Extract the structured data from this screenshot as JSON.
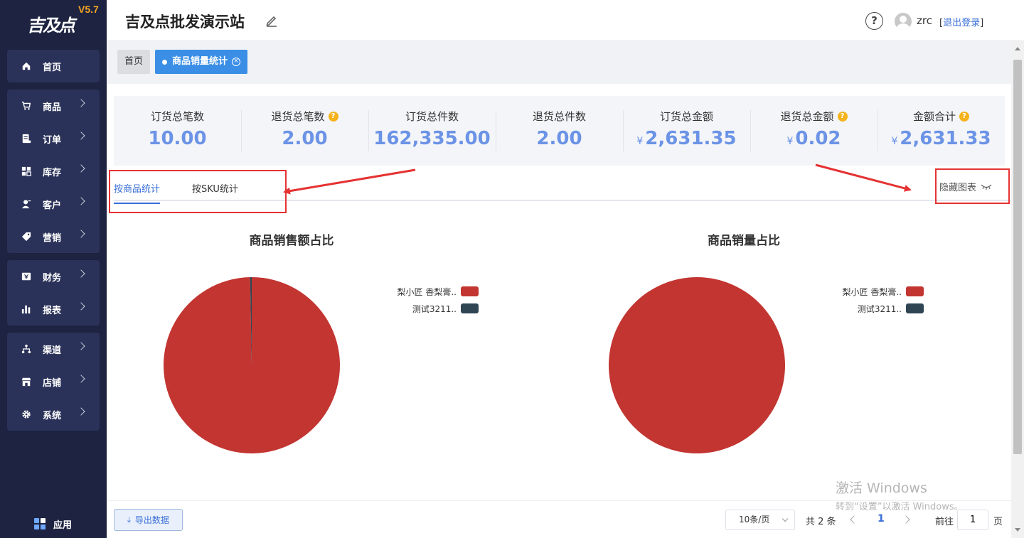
{
  "sidebar": {
    "logo_text": "吉及点",
    "version": "V5.7",
    "groups": [
      [
        {
          "label": "首页",
          "icon": "home-icon",
          "chevron": false
        }
      ],
      [
        {
          "label": "商品",
          "icon": "cart-icon",
          "chevron": true
        },
        {
          "label": "订单",
          "icon": "order-icon",
          "chevron": true
        },
        {
          "label": "库存",
          "icon": "stock-icon",
          "chevron": true
        },
        {
          "label": "客户",
          "icon": "customer-icon",
          "chevron": true
        },
        {
          "label": "营销",
          "icon": "tag-icon",
          "chevron": true
        }
      ],
      [
        {
          "label": "财务",
          "icon": "finance-icon",
          "chevron": true
        },
        {
          "label": "报表",
          "icon": "report-icon",
          "chevron": true
        }
      ],
      [
        {
          "label": "渠道",
          "icon": "channel-icon",
          "chevron": true
        },
        {
          "label": "店铺",
          "icon": "store-icon",
          "chevron": true
        },
        {
          "label": "系统",
          "icon": "gear-icon",
          "chevron": true
        }
      ]
    ],
    "app_label": "应用"
  },
  "header": {
    "title": "吉及点批发演示站",
    "help": "?",
    "username": "zrc",
    "logout_open": "[",
    "logout_label": "退出登录",
    "logout_close": "]"
  },
  "tabs": {
    "home": "首页",
    "active": "商品销量统计",
    "close": "×"
  },
  "stats": [
    {
      "label": "订货总笔数",
      "value": "10.00",
      "help": false,
      "currency": ""
    },
    {
      "label": "退货总笔数",
      "value": "2.00",
      "help": true,
      "currency": ""
    },
    {
      "label": "订货总件数",
      "value": "162,335.00",
      "help": false,
      "currency": ""
    },
    {
      "label": "退货总件数",
      "value": "2.00",
      "help": false,
      "currency": ""
    },
    {
      "label": "订货总金额",
      "value": "2,631.35",
      "help": false,
      "currency": "¥"
    },
    {
      "label": "退货总金额",
      "value": "0.02",
      "help": true,
      "currency": "¥"
    },
    {
      "label": "金额合计",
      "value": "2,631.33",
      "help": true,
      "currency": "¥"
    }
  ],
  "help_glyph": "?",
  "subtabs": {
    "by_product": "按商品统计",
    "by_sku": "按SKU统计"
  },
  "hide_chart_label": "隐藏图表",
  "chart_data": [
    {
      "type": "pie",
      "title": "商品销售额占比",
      "categories": [
        "梨小匠 香梨膏..",
        "测试3211.."
      ],
      "values": [
        99.7,
        0.3
      ],
      "colors": [
        "#c23531",
        "#2f4554"
      ],
      "legend": "right"
    },
    {
      "type": "pie",
      "title": "商品销量占比",
      "categories": [
        "梨小匠 香梨膏..",
        "测试3211.."
      ],
      "values": [
        100,
        0
      ],
      "colors": [
        "#c23531",
        "#2f4554"
      ],
      "legend": "right"
    }
  ],
  "pagination": {
    "export_label": "导出数据",
    "export_icon": "download-icon",
    "page_size": "10条/页",
    "total": "共 2 条",
    "current_page": "1",
    "goto_label": "前往",
    "goto_value": "1",
    "goto_suffix": "页"
  },
  "watermark": {
    "line1": "激活 Windows",
    "line2": "转到“设置”以激活 Windows。"
  },
  "colors": {
    "sidebar_bg": "#1d2340",
    "accent": "#3a6fd8",
    "stat_value": "#6b93e6",
    "annotation": "#e53232"
  }
}
